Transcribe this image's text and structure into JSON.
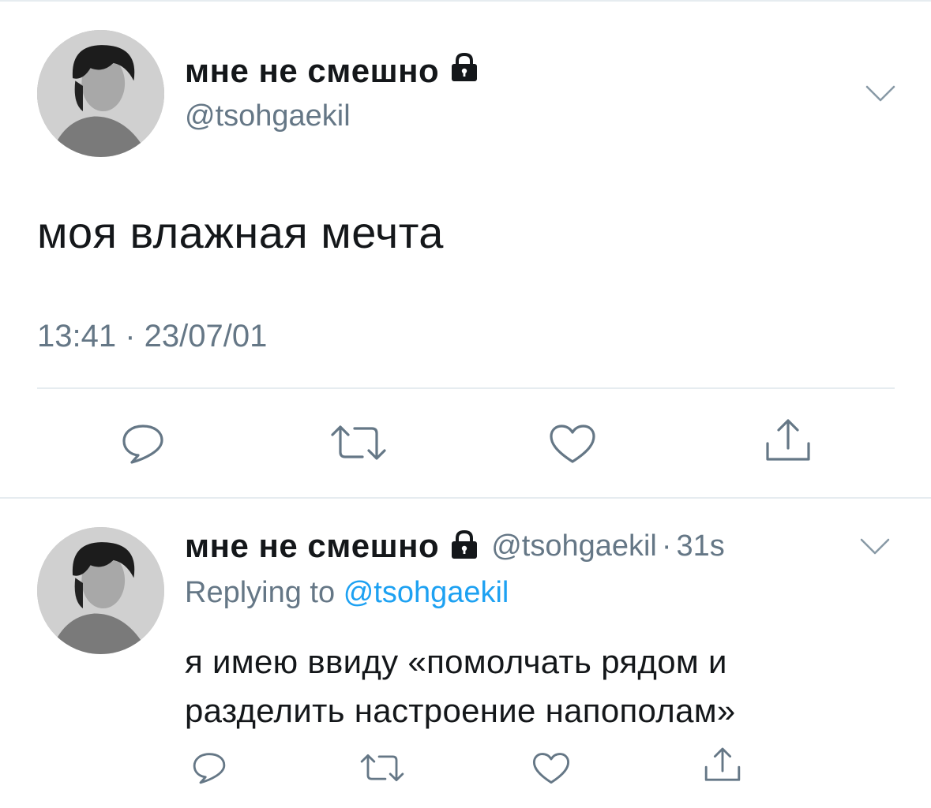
{
  "main_tweet": {
    "display_name": "мне не смешно",
    "handle": "@tsohgaekil",
    "text": "моя влажная мечта",
    "timestamp": "13:41 · 23/07/01",
    "icons": [
      "lock-icon",
      "chevron-down-icon",
      "reply-icon",
      "retweet-icon",
      "like-icon",
      "share-icon"
    ]
  },
  "reply_tweet": {
    "display_name": "мне не смешно",
    "handle": "@tsohgaekil",
    "separator": "·",
    "age": "31s",
    "replying_prefix": "Replying to",
    "replying_to": "@tsohgaekil",
    "text": "я имею ввиду «помолчать рядом и разделить настроение напополам»",
    "icons": [
      "lock-icon",
      "chevron-down-icon",
      "reply-icon",
      "retweet-icon",
      "like-icon",
      "share-icon"
    ]
  },
  "colors": {
    "text": "#14171a",
    "secondary": "#657786",
    "link": "#1da1f2",
    "divider": "#e6ecf0"
  }
}
